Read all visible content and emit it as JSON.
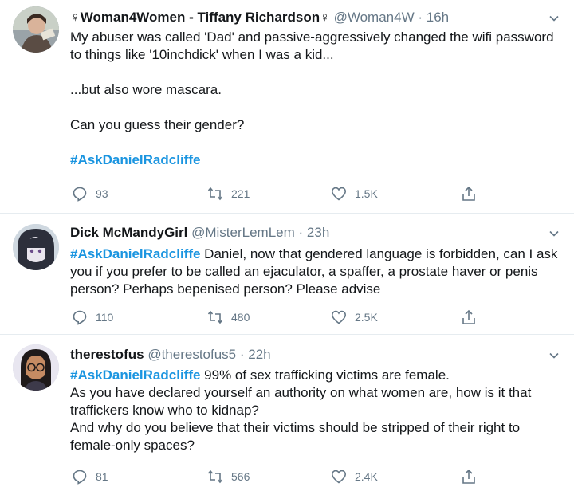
{
  "tweets": [
    {
      "name": "♀Woman4Women - Tiffany Richardson♀",
      "handle": "@Woman4W",
      "sep": " · ",
      "time": "16h",
      "hashtag": "#AskDanielRadcliffe",
      "lines": [
        "My abuser was called 'Dad' and passive-aggressively changed the wifi password to things like '10inchdick' when I was a kid...",
        "...but also wore mascara.",
        "Can you guess their gender?"
      ],
      "replies": "93",
      "retweets": "221",
      "likes": "1.5K",
      "avatar_icon": "person-photo-icon"
    },
    {
      "name": "Dick McMandyGirl",
      "handle": "@MisterLemLem",
      "sep": " · ",
      "time": "23h",
      "hashtag": "#AskDanielRadcliffe",
      "text": " Daniel, now that gendered language is forbidden, can I ask you if you prefer to be called an ejaculator, a spaffer, a prostate haver or penis person? Perhaps bepenised person? Please advise",
      "replies": "110",
      "retweets": "480",
      "likes": "2.5K",
      "avatar_icon": "illustrated-person-icon"
    },
    {
      "name": "therestofus",
      "handle": "@therestofus5",
      "sep": " · ",
      "time": "22h",
      "hashtag": "#AskDanielRadcliffe",
      "text": " 99% of sex trafficking victims are female.",
      "lines": [
        "As you have declared yourself an authority on what women are, how is it that traffickers know who to kidnap?",
        "And why do you believe that their victims should be stripped of their right to female-only spaces?"
      ],
      "replies": "81",
      "retweets": "566",
      "likes": "2.4K",
      "avatar_icon": "cartoon-woman-glasses-icon"
    }
  ],
  "colors": {
    "link": "#1b95e0",
    "meta": "#657786",
    "text": "#14171a",
    "divider": "#e6ecf0"
  }
}
